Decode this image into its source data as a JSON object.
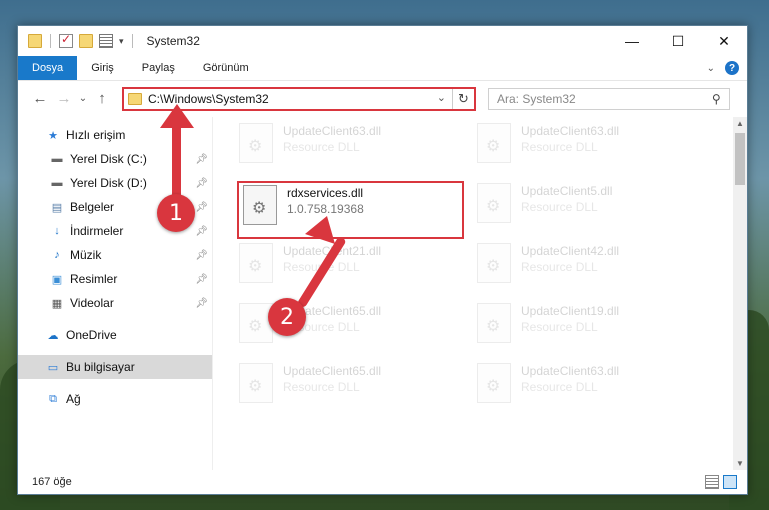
{
  "window": {
    "title": "System32"
  },
  "titlebar_controls": {
    "minimize": "—",
    "maximize": "☐",
    "close": "✕"
  },
  "ribbon": {
    "tabs": [
      {
        "label": "Dosya",
        "active": true
      },
      {
        "label": "Giriş"
      },
      {
        "label": "Paylaş"
      },
      {
        "label": "Görünüm"
      }
    ],
    "help": "?"
  },
  "nav": {
    "back": "←",
    "forward": "→",
    "recent": "⌄",
    "up": "↑"
  },
  "address": {
    "path": "C:\\Windows\\System32",
    "refresh": "↻"
  },
  "search": {
    "placeholder": "Ara: System32",
    "icon": "search-icon"
  },
  "sidebar": {
    "items": [
      {
        "label": "Hızlı erişim",
        "icon": "star-icon"
      },
      {
        "label": "Yerel Disk (C:)",
        "icon": "drive-icon",
        "pinned": true
      },
      {
        "label": "Yerel Disk (D:)",
        "icon": "drive-icon",
        "pinned": true
      },
      {
        "label": "Belgeler",
        "icon": "documents-icon",
        "pinned": true
      },
      {
        "label": "İndirmeler",
        "icon": "download-icon",
        "pinned": true
      },
      {
        "label": "Müzik",
        "icon": "music-icon",
        "pinned": true
      },
      {
        "label": "Resimler",
        "icon": "pictures-icon",
        "pinned": true
      },
      {
        "label": "Videolar",
        "icon": "videos-icon",
        "pinned": true
      },
      {
        "label": "OneDrive",
        "icon": "cloud-icon"
      },
      {
        "label": "Bu bilgisayar",
        "icon": "computer-icon",
        "selected": true
      },
      {
        "label": "Ağ",
        "icon": "network-icon"
      }
    ]
  },
  "files": [
    {
      "name": "UpdateClient63.dll",
      "desc": "Resource DLL"
    },
    {
      "name": "UpdateClient63.dll",
      "desc": "Resource DLL"
    },
    {
      "name": "rdxservices.dll",
      "desc": "1.0.758.19368",
      "highlight": true
    },
    {
      "name": "UpdateClient5.dll",
      "desc": "Resource DLL"
    },
    {
      "name": "UpdateClient21.dll",
      "desc": "Resource DLL"
    },
    {
      "name": "UpdateClient42.dll",
      "desc": "Resource DLL"
    },
    {
      "name": "UpdateClient65.dll",
      "desc": "Resource DLL"
    },
    {
      "name": "UpdateClient19.dll",
      "desc": "Resource DLL"
    },
    {
      "name": "UpdateClient65.dll",
      "desc": "Resource DLL"
    },
    {
      "name": "UpdateClient63.dll",
      "desc": "Resource DLL"
    }
  ],
  "status": {
    "count": "167 öğe"
  },
  "annotations": {
    "step1": "1",
    "step2": "2"
  },
  "colors": {
    "accent": "#1979ca",
    "highlight": "#d9363e"
  }
}
